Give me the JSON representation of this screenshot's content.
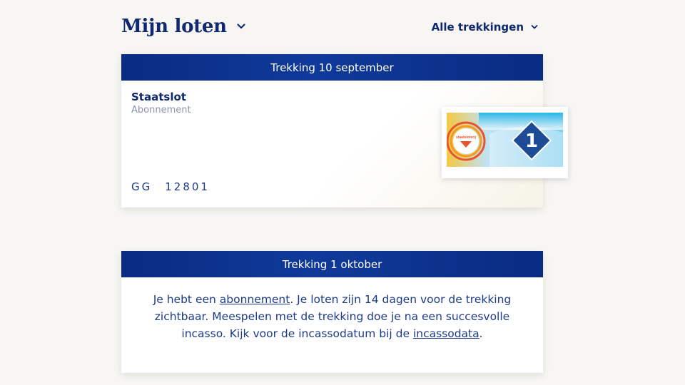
{
  "header": {
    "title": "Mijn loten",
    "filter_label": "Alle trekkingen"
  },
  "draw1": {
    "header": "Trekking 10 september",
    "ticket": {
      "name": "Staatslot",
      "type": "Abonnement",
      "series": "GG",
      "number": "12801"
    },
    "thumbnail": {
      "logo_text": "staatsloterij",
      "badge": "1"
    }
  },
  "draw2": {
    "header": "Trekking 1 oktober",
    "message": {
      "part1": "Je hebt een ",
      "link1": "abonnement",
      "part2": ". Je loten zijn 14 dagen voor de trekking zichtbaar. Meespelen met de trekking doe je na een succesvolle incasso. Kijk voor de incassodatum bij de ",
      "link2": "incassodata",
      "part3": "."
    }
  },
  "colors": {
    "navy": "#0f2870",
    "header_blue": "#0a2b82",
    "background": "#f7f6f2"
  }
}
